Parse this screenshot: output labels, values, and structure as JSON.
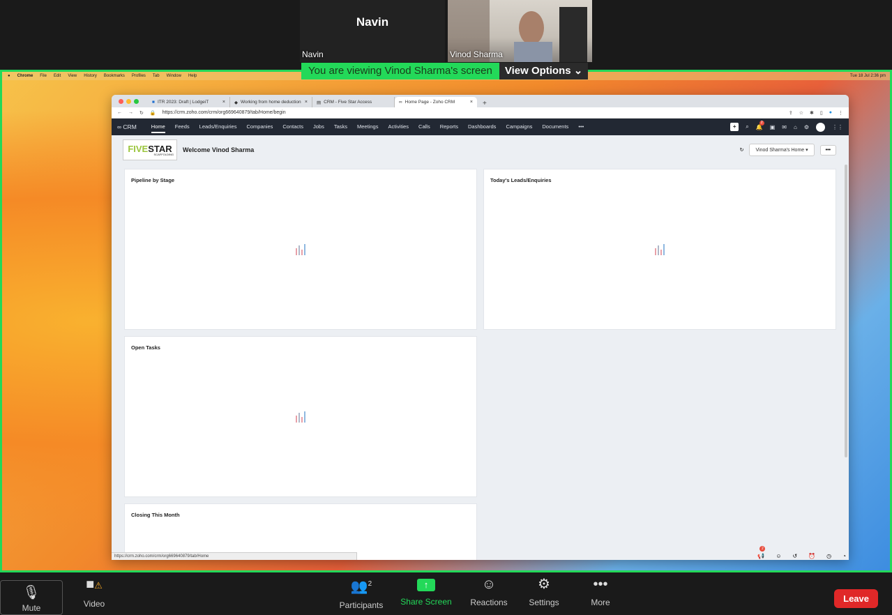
{
  "meeting": {
    "participants": [
      {
        "name": "Navin",
        "label": "Navin"
      },
      {
        "name": "",
        "label": "Vinod Sharma"
      }
    ],
    "viewing_message": "You are viewing Vinod Sharma's screen",
    "view_options": "View Options ⌄"
  },
  "mac_menu": {
    "app": "Chrome",
    "items": [
      "File",
      "Edit",
      "View",
      "History",
      "Bookmarks",
      "Profiles",
      "Tab",
      "Window",
      "Help"
    ],
    "clock": "Tue 18 Jul 2:36 pm"
  },
  "browser": {
    "tabs": [
      {
        "title": "ITR 2023: Draft | LodgeiT"
      },
      {
        "title": "Working from home deduction"
      },
      {
        "title": "CRM - Five Star Access"
      },
      {
        "title": "Home Page - Zoho CRM",
        "active": true
      }
    ],
    "url": "https://crm.zoho.com/crm/org669640879/tab/Home/begin",
    "status_url": "https://crm.zoho.com/crm/org669640879/tab/Home"
  },
  "crm": {
    "logo": "CRM",
    "nav": [
      "Home",
      "Feeds",
      "Leads/Enquiries",
      "Companies",
      "Contacts",
      "Jobs",
      "Tasks",
      "Meetings",
      "Activities",
      "Calls",
      "Reports",
      "Dashboards",
      "Campaigns",
      "Documents",
      "•••"
    ],
    "notif_count": "2",
    "company_logo": {
      "line1a": "FIVE",
      "line1b": "STAR",
      "line2": "SCAFFOLDING"
    },
    "welcome": "Welcome Vinod Sharma",
    "home_select": "Vinod Sharma's Home",
    "more_btn": "•••",
    "cards": [
      "Pipeline by Stage",
      "Today's Leads/Enquiries",
      "Open Tasks",
      "Closing This Month"
    ],
    "bottom_badge": "2"
  },
  "toolbar": {
    "mute": "Mute",
    "video": "Video",
    "participants": "Participants",
    "participants_count": "2",
    "share": "Share Screen",
    "reactions": "Reactions",
    "settings": "Settings",
    "more": "More",
    "leave": "Leave"
  },
  "colors": {
    "zoom_green": "#23d959",
    "leave_red": "#e02828",
    "crm_nav": "#222833"
  }
}
